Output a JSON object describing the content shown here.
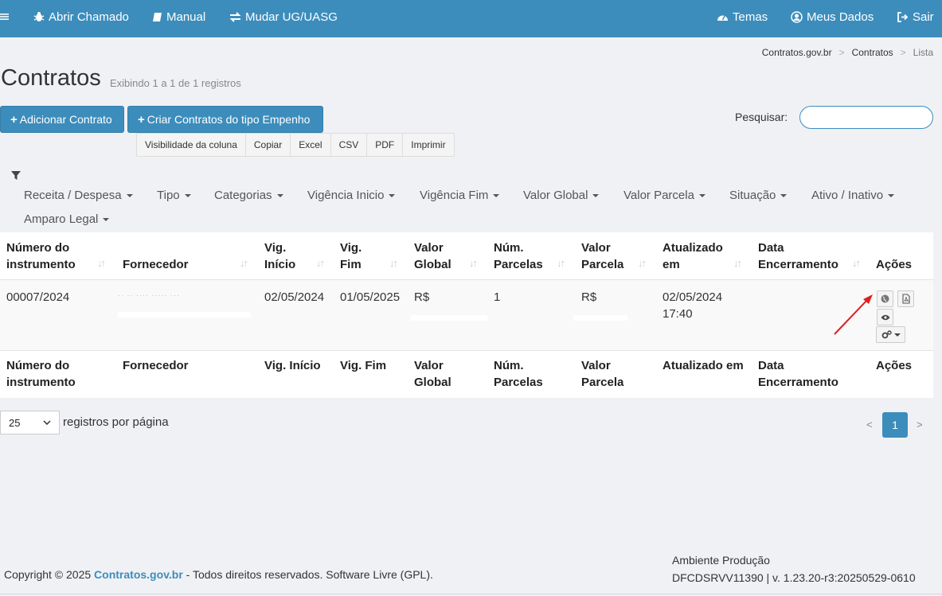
{
  "topbar": {
    "open_ticket": "Abrir Chamado",
    "manual": "Manual",
    "change_ug": "Mudar UG/UASG",
    "themes": "Temas",
    "my_data": "Meus Dados",
    "logout": "Sair"
  },
  "breadcrumb": {
    "home": "Contratos.gov.br",
    "section": "Contratos",
    "current": "Lista"
  },
  "page": {
    "title": "Contratos",
    "subtitle": "Exibindo 1 a 1 de 1 registros"
  },
  "actions": {
    "add_contract": "Adicionar Contrato",
    "create_empenho": "Criar Contratos do tipo Empenho"
  },
  "export_buttons": [
    "Visibilidade da coluna",
    "Copiar",
    "Excel",
    "CSV",
    "PDF",
    "Imprimir"
  ],
  "search": {
    "label": "Pesquisar:",
    "value": ""
  },
  "filters": [
    "Receita / Despesa",
    "Tipo",
    "Categorias",
    "Vigência Inicio",
    "Vigência Fim",
    "Valor Global",
    "Valor Parcela",
    "Situação",
    "Ativo / Inativo",
    "Amparo Legal"
  ],
  "table": {
    "headers": {
      "numero_l1": "Número do",
      "numero_l2": "instrumento",
      "fornecedor": "Fornecedor",
      "vig_inicio_l1": "Vig.",
      "vig_inicio_l2": "Início",
      "vig_fim_l1": "Vig.",
      "vig_fim_l2": "Fim",
      "valor_global_l1": "Valor",
      "valor_global_l2": "Global",
      "num_parcelas_l1": "Núm.",
      "num_parcelas_l2": "Parcelas",
      "valor_parcela_l1": "Valor",
      "valor_parcela_l2": "Parcela",
      "atualizado_l1": "Atualizado",
      "atualizado_l2": "em",
      "encerramento_l1": "Data",
      "encerramento_l2": "Encerramento",
      "acoes": "Ações"
    },
    "footer_headers": {
      "numero_l1": "Número do",
      "numero_l2": "instrumento",
      "fornecedor": "Fornecedor",
      "vig_inicio": "Vig. Início",
      "vig_fim": "Vig. Fim",
      "valor_global_l1": "Valor",
      "valor_global_l2": "Global",
      "num_parcelas_l1": "Núm.",
      "num_parcelas_l2": "Parcelas",
      "valor_parcela_l1": "Valor",
      "valor_parcela_l2": "Parcela",
      "atualizado": "Atualizado em",
      "encerramento_l1": "Data",
      "encerramento_l2": "Encerramento",
      "acoes": "Ações"
    },
    "row": {
      "numero": "00007/2024",
      "vig_inicio": "02/05/2024",
      "vig_fim": "01/05/2025",
      "valor_global": "R$",
      "num_parcelas": "1",
      "valor_parcela": "R$",
      "atualizado_date": "02/05/2024",
      "atualizado_time": "17:40"
    }
  },
  "pagination": {
    "per_page": "25",
    "per_page_label": "registros por página",
    "prev": "<",
    "page": "1",
    "next": ">"
  },
  "footer": {
    "copyright_prefix": "Copyright © 2025 ",
    "site": "Contratos.gov.br",
    "copyright_suffix": " - Todos direitos reservados. Software Livre (GPL).",
    "environment": "Ambiente Produção",
    "version": "DFCDSRVV11390 | v. 1.23.20-r3:20250529-0610"
  },
  "colors": {
    "primary": "#3c8dbc",
    "annotation_arrow": "#e02020"
  }
}
